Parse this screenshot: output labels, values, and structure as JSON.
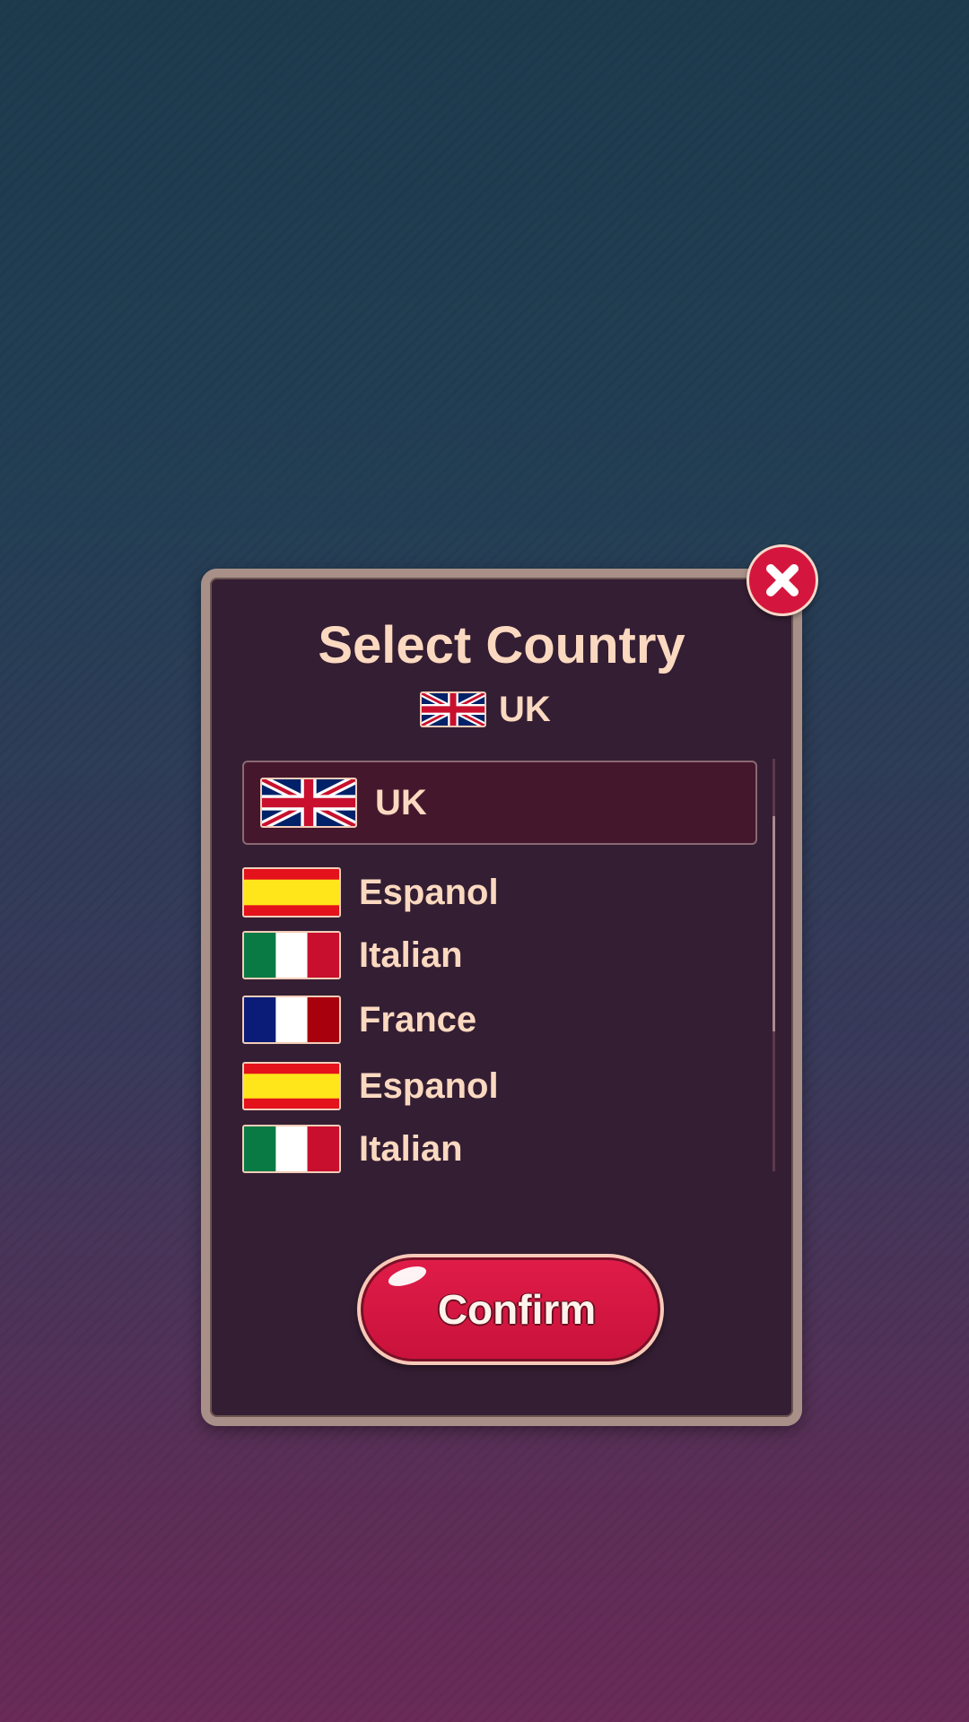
{
  "dialog": {
    "title": "Select Country",
    "current": {
      "label": "UK",
      "flag": "uk-flag"
    }
  },
  "countries": [
    {
      "label": "UK",
      "flag": "uk-flag",
      "selected": true
    },
    {
      "label": "Espanol",
      "flag": "spain-flag"
    },
    {
      "label": "Italian",
      "flag": "italy-flag"
    },
    {
      "label": "France",
      "flag": "france-flag"
    },
    {
      "label": "Espanol",
      "flag": "spain-flag"
    },
    {
      "label": "Italian",
      "flag": "italy-flag"
    }
  ],
  "buttons": {
    "confirm_label": "Confirm",
    "close_icon": "close-icon"
  },
  "colors": {
    "accent": "#d4163e",
    "text": "#fbd9c0",
    "panel": "#341e33"
  }
}
